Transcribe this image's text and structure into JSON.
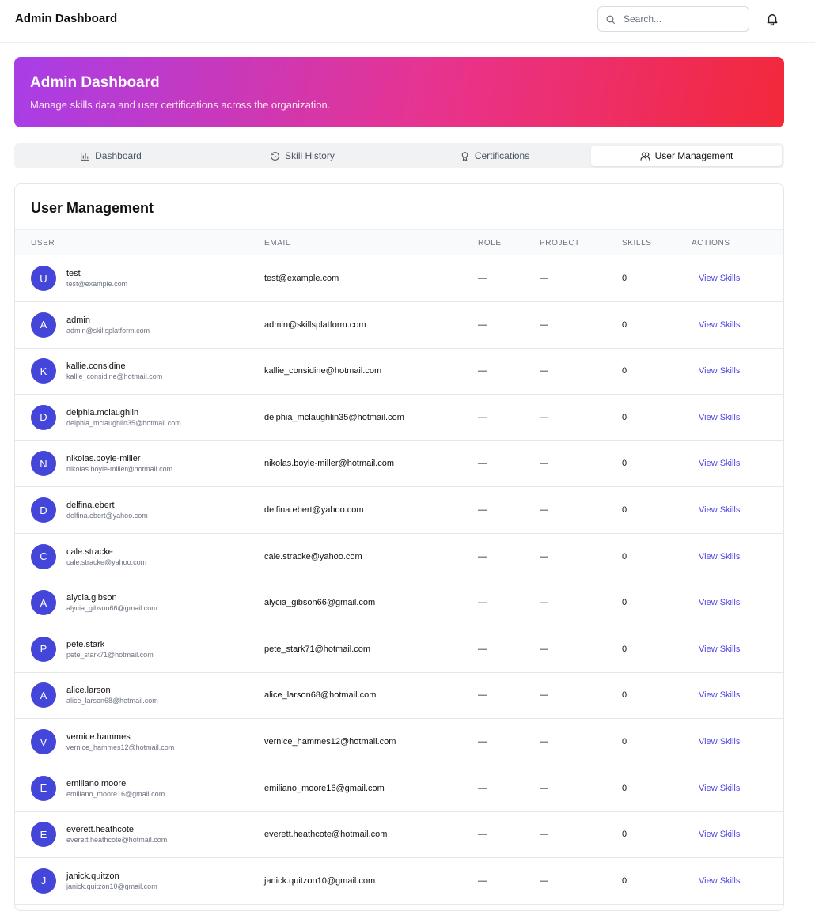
{
  "header": {
    "app_title": "Admin Dashboard",
    "search_placeholder": "Search..."
  },
  "banner": {
    "title": "Admin Dashboard",
    "subtitle": "Manage skills data and user certifications across the organization."
  },
  "tabs": [
    {
      "label": "Dashboard",
      "icon": "bar-chart-icon",
      "active": false
    },
    {
      "label": "Skill History",
      "icon": "history-icon",
      "active": false
    },
    {
      "label": "Certifications",
      "icon": "award-icon",
      "active": false
    },
    {
      "label": "User Management",
      "icon": "users-icon",
      "active": true
    }
  ],
  "user_management": {
    "title": "User Management",
    "columns": [
      "USER",
      "EMAIL",
      "ROLE",
      "PROJECT",
      "SKILLS",
      "ACTIONS"
    ],
    "rows": [
      {
        "initial": "U",
        "username": "test",
        "sub_email": "test@example.com",
        "email": "test@example.com",
        "role": "—",
        "project": "—",
        "skills": "0",
        "action": "View Skills"
      },
      {
        "initial": "A",
        "username": "admin",
        "sub_email": "admin@skillsplatform.com",
        "email": "admin@skillsplatform.com",
        "role": "—",
        "project": "—",
        "skills": "0",
        "action": "View Skills"
      },
      {
        "initial": "K",
        "username": "kallie.considine",
        "sub_email": "kallie_considine@hotmail.com",
        "email": "kallie_considine@hotmail.com",
        "role": "—",
        "project": "—",
        "skills": "0",
        "action": "View Skills"
      },
      {
        "initial": "D",
        "username": "delphia.mclaughlin",
        "sub_email": "delphia_mclaughlin35@hotmail.com",
        "email": "delphia_mclaughlin35@hotmail.com",
        "role": "—",
        "project": "—",
        "skills": "0",
        "action": "View Skills"
      },
      {
        "initial": "N",
        "username": "nikolas.boyle-miller",
        "sub_email": "nikolas.boyle-miller@hotmail.com",
        "email": "nikolas.boyle-miller@hotmail.com",
        "role": "—",
        "project": "—",
        "skills": "0",
        "action": "View Skills"
      },
      {
        "initial": "D",
        "username": "delfina.ebert",
        "sub_email": "delfina.ebert@yahoo.com",
        "email": "delfina.ebert@yahoo.com",
        "role": "—",
        "project": "—",
        "skills": "0",
        "action": "View Skills"
      },
      {
        "initial": "C",
        "username": "cale.stracke",
        "sub_email": "cale.stracke@yahoo.com",
        "email": "cale.stracke@yahoo.com",
        "role": "—",
        "project": "—",
        "skills": "0",
        "action": "View Skills"
      },
      {
        "initial": "A",
        "username": "alycia.gibson",
        "sub_email": "alycia_gibson66@gmail.com",
        "email": "alycia_gibson66@gmail.com",
        "role": "—",
        "project": "—",
        "skills": "0",
        "action": "View Skills"
      },
      {
        "initial": "P",
        "username": "pete.stark",
        "sub_email": "pete_stark71@hotmail.com",
        "email": "pete_stark71@hotmail.com",
        "role": "—",
        "project": "—",
        "skills": "0",
        "action": "View Skills"
      },
      {
        "initial": "A",
        "username": "alice.larson",
        "sub_email": "alice_larson68@hotmail.com",
        "email": "alice_larson68@hotmail.com",
        "role": "—",
        "project": "—",
        "skills": "0",
        "action": "View Skills"
      },
      {
        "initial": "V",
        "username": "vernice.hammes",
        "sub_email": "vernice_hammes12@hotmail.com",
        "email": "vernice_hammes12@hotmail.com",
        "role": "—",
        "project": "—",
        "skills": "0",
        "action": "View Skills"
      },
      {
        "initial": "E",
        "username": "emiliano.moore",
        "sub_email": "emiliano_moore16@gmail.com",
        "email": "emiliano_moore16@gmail.com",
        "role": "—",
        "project": "—",
        "skills": "0",
        "action": "View Skills"
      },
      {
        "initial": "E",
        "username": "everett.heathcote",
        "sub_email": "everett.heathcote@hotmail.com",
        "email": "everett.heathcote@hotmail.com",
        "role": "—",
        "project": "—",
        "skills": "0",
        "action": "View Skills"
      },
      {
        "initial": "J",
        "username": "janick.quitzon",
        "sub_email": "janick.quitzon10@gmail.com",
        "email": "janick.quitzon10@gmail.com",
        "role": "—",
        "project": "—",
        "skills": "0",
        "action": "View Skills"
      }
    ]
  },
  "colors": {
    "accent": "#4f46e5",
    "avatar": "#4446d9",
    "banner_gradient": [
      "#a83ee8",
      "#e8338e",
      "#f3283a"
    ]
  }
}
